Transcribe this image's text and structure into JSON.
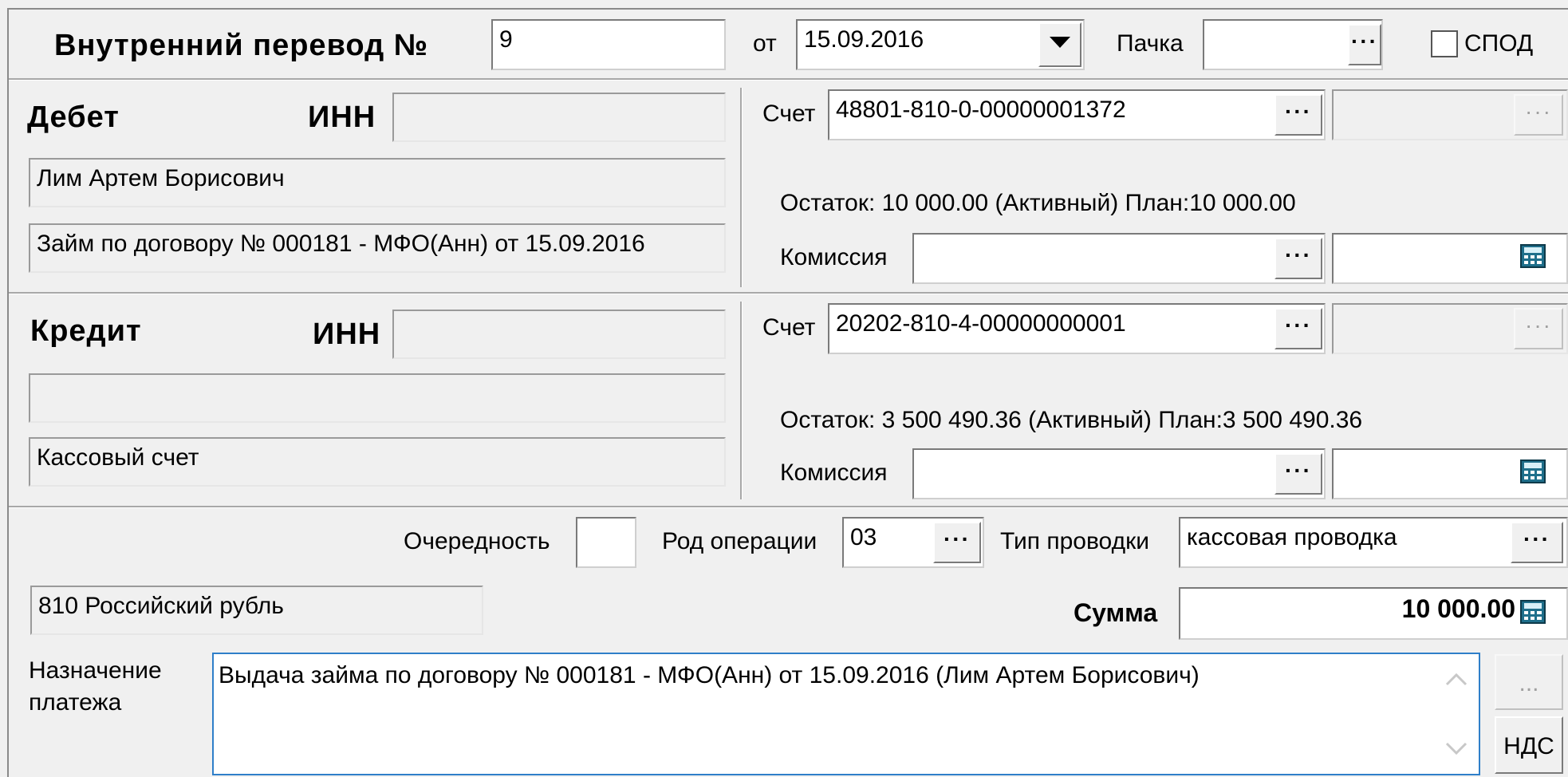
{
  "header": {
    "title": "Внутренний перевод №",
    "number": "9",
    "from_label": "от",
    "date": "15.09.2016",
    "batch_label": "Пачка",
    "batch_value": "",
    "spod_label": "СПОД",
    "spod_checked": false
  },
  "debit": {
    "section_label": "Дебет",
    "inn_label": "ИНН",
    "inn_value": "",
    "name": "Лим Артем Борисович",
    "description": "Займ по договору № 000181 - МФО(Анн) от 15.09.2016",
    "account_label": "Счет",
    "account": "48801-810-0-00000001372",
    "account_extra": "",
    "balance": "Остаток: 10 000.00 (Активный) План:10 000.00",
    "commission_label": "Комиссия",
    "commission_account": "",
    "commission_amount": ""
  },
  "credit": {
    "section_label": "Кредит",
    "inn_label": "ИНН",
    "inn_value": "",
    "name": "",
    "description": "Кассовый счет",
    "account_label": "Счет",
    "account": "20202-810-4-00000000001",
    "account_extra": "",
    "balance": "Остаток: 3 500 490.36 (Активный) План:3 500 490.36",
    "commission_label": "Комиссия",
    "commission_account": "",
    "commission_amount": ""
  },
  "details": {
    "priority_label": "Очередность",
    "priority_value": "",
    "operation_label": "Род операции",
    "operation_value": "03",
    "entry_type_label": "Тип проводки",
    "entry_type_value": "кассовая проводка",
    "currency": "810 Российский рубль",
    "sum_label": "Сумма",
    "sum_value": "10 000.00",
    "purpose_label_line1": "Назначение",
    "purpose_label_line2": "платежа",
    "purpose_text": "Выдача займа по договору № 000181 - МФО(Анн) от 15.09.2016 (Лим Артем Борисович)",
    "more_button": "...",
    "vat_button": "НДС"
  },
  "ui": {
    "ellipsis": "···",
    "calc_color": "#1f6f8b",
    "focus_color": "#2f7fc9"
  }
}
